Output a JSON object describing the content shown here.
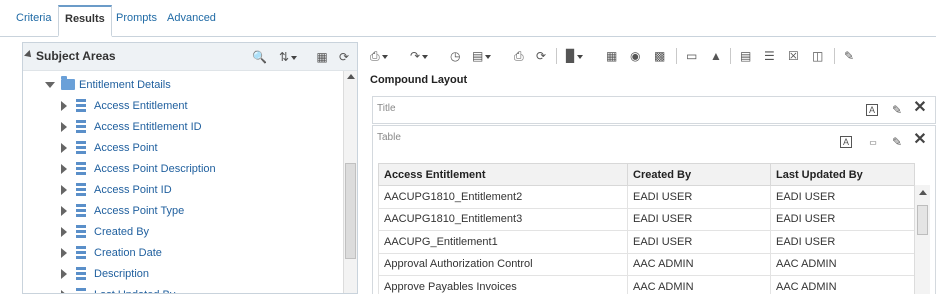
{
  "tabs": [
    {
      "label": "Criteria",
      "active": false
    },
    {
      "label": "Results",
      "active": true
    },
    {
      "label": "Prompts",
      "active": false
    },
    {
      "label": "Advanced",
      "active": false
    }
  ],
  "subject_areas": {
    "title": "Subject Areas",
    "folder": "Entitlement Details",
    "columns": [
      "Access Entitlement",
      "Access Entitlement ID",
      "Access Point",
      "Access Point Description",
      "Access Point ID",
      "Access Point Type",
      "Created By",
      "Creation Date",
      "Description",
      "Last Updated By"
    ]
  },
  "layout": {
    "title": "Compound Layout",
    "title_view_label": "Title",
    "table_view_label": "Table"
  },
  "table": {
    "headers": [
      "Access Entitlement",
      "Created By",
      "Last Updated By"
    ],
    "rows": [
      [
        "AACUPG1810_Entitlement2",
        "EADI USER",
        "EADI USER"
      ],
      [
        "AACUPG1810_Entitlement3",
        "EADI USER",
        "EADI USER"
      ],
      [
        "AACUPG_Entitlement1",
        "EADI USER",
        "EADI USER"
      ],
      [
        "Approval Authorization Control",
        "AAC ADMIN",
        "AAC ADMIN"
      ],
      [
        "Approve Payables Invoices",
        "AAC ADMIN",
        "AAC ADMIN"
      ]
    ]
  },
  "colors": {
    "link": "#1f5f9e",
    "accent": "#6b9bc8",
    "border": "#c9d3dc"
  }
}
